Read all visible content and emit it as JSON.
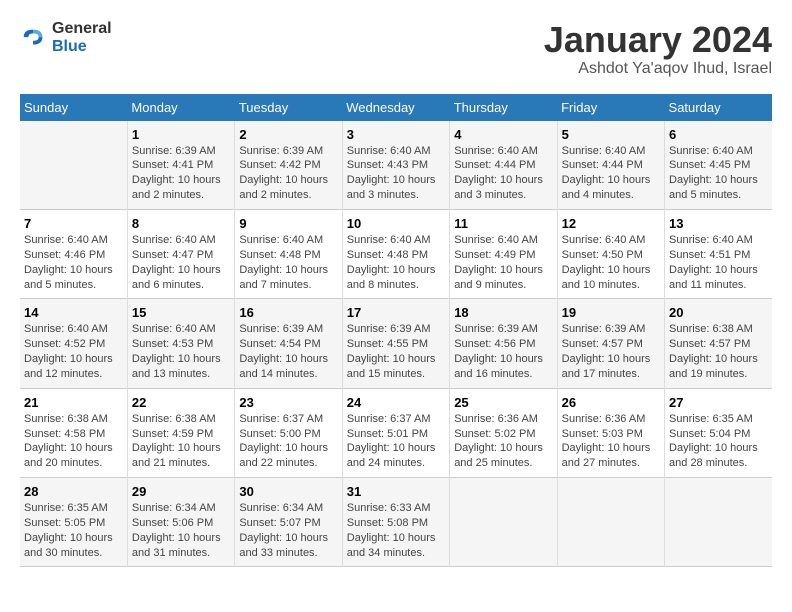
{
  "header": {
    "logo_general": "General",
    "logo_blue": "Blue",
    "title": "January 2024",
    "subtitle": "Ashdot Ya'aqov Ihud, Israel"
  },
  "weekdays": [
    "Sunday",
    "Monday",
    "Tuesday",
    "Wednesday",
    "Thursday",
    "Friday",
    "Saturday"
  ],
  "weeks": [
    [
      {
        "day": "",
        "lines": []
      },
      {
        "day": "1",
        "lines": [
          "Sunrise: 6:39 AM",
          "Sunset: 4:41 PM",
          "Daylight: 10 hours",
          "and 2 minutes."
        ]
      },
      {
        "day": "2",
        "lines": [
          "Sunrise: 6:39 AM",
          "Sunset: 4:42 PM",
          "Daylight: 10 hours",
          "and 2 minutes."
        ]
      },
      {
        "day": "3",
        "lines": [
          "Sunrise: 6:40 AM",
          "Sunset: 4:43 PM",
          "Daylight: 10 hours",
          "and 3 minutes."
        ]
      },
      {
        "day": "4",
        "lines": [
          "Sunrise: 6:40 AM",
          "Sunset: 4:44 PM",
          "Daylight: 10 hours",
          "and 3 minutes."
        ]
      },
      {
        "day": "5",
        "lines": [
          "Sunrise: 6:40 AM",
          "Sunset: 4:44 PM",
          "Daylight: 10 hours",
          "and 4 minutes."
        ]
      },
      {
        "day": "6",
        "lines": [
          "Sunrise: 6:40 AM",
          "Sunset: 4:45 PM",
          "Daylight: 10 hours",
          "and 5 minutes."
        ]
      }
    ],
    [
      {
        "day": "7",
        "lines": [
          "Sunrise: 6:40 AM",
          "Sunset: 4:46 PM",
          "Daylight: 10 hours",
          "and 5 minutes."
        ]
      },
      {
        "day": "8",
        "lines": [
          "Sunrise: 6:40 AM",
          "Sunset: 4:47 PM",
          "Daylight: 10 hours",
          "and 6 minutes."
        ]
      },
      {
        "day": "9",
        "lines": [
          "Sunrise: 6:40 AM",
          "Sunset: 4:48 PM",
          "Daylight: 10 hours",
          "and 7 minutes."
        ]
      },
      {
        "day": "10",
        "lines": [
          "Sunrise: 6:40 AM",
          "Sunset: 4:48 PM",
          "Daylight: 10 hours",
          "and 8 minutes."
        ]
      },
      {
        "day": "11",
        "lines": [
          "Sunrise: 6:40 AM",
          "Sunset: 4:49 PM",
          "Daylight: 10 hours",
          "and 9 minutes."
        ]
      },
      {
        "day": "12",
        "lines": [
          "Sunrise: 6:40 AM",
          "Sunset: 4:50 PM",
          "Daylight: 10 hours",
          "and 10 minutes."
        ]
      },
      {
        "day": "13",
        "lines": [
          "Sunrise: 6:40 AM",
          "Sunset: 4:51 PM",
          "Daylight: 10 hours",
          "and 11 minutes."
        ]
      }
    ],
    [
      {
        "day": "14",
        "lines": [
          "Sunrise: 6:40 AM",
          "Sunset: 4:52 PM",
          "Daylight: 10 hours",
          "and 12 minutes."
        ]
      },
      {
        "day": "15",
        "lines": [
          "Sunrise: 6:40 AM",
          "Sunset: 4:53 PM",
          "Daylight: 10 hours",
          "and 13 minutes."
        ]
      },
      {
        "day": "16",
        "lines": [
          "Sunrise: 6:39 AM",
          "Sunset: 4:54 PM",
          "Daylight: 10 hours",
          "and 14 minutes."
        ]
      },
      {
        "day": "17",
        "lines": [
          "Sunrise: 6:39 AM",
          "Sunset: 4:55 PM",
          "Daylight: 10 hours",
          "and 15 minutes."
        ]
      },
      {
        "day": "18",
        "lines": [
          "Sunrise: 6:39 AM",
          "Sunset: 4:56 PM",
          "Daylight: 10 hours",
          "and 16 minutes."
        ]
      },
      {
        "day": "19",
        "lines": [
          "Sunrise: 6:39 AM",
          "Sunset: 4:57 PM",
          "Daylight: 10 hours",
          "and 17 minutes."
        ]
      },
      {
        "day": "20",
        "lines": [
          "Sunrise: 6:38 AM",
          "Sunset: 4:57 PM",
          "Daylight: 10 hours",
          "and 19 minutes."
        ]
      }
    ],
    [
      {
        "day": "21",
        "lines": [
          "Sunrise: 6:38 AM",
          "Sunset: 4:58 PM",
          "Daylight: 10 hours",
          "and 20 minutes."
        ]
      },
      {
        "day": "22",
        "lines": [
          "Sunrise: 6:38 AM",
          "Sunset: 4:59 PM",
          "Daylight: 10 hours",
          "and 21 minutes."
        ]
      },
      {
        "day": "23",
        "lines": [
          "Sunrise: 6:37 AM",
          "Sunset: 5:00 PM",
          "Daylight: 10 hours",
          "and 22 minutes."
        ]
      },
      {
        "day": "24",
        "lines": [
          "Sunrise: 6:37 AM",
          "Sunset: 5:01 PM",
          "Daylight: 10 hours",
          "and 24 minutes."
        ]
      },
      {
        "day": "25",
        "lines": [
          "Sunrise: 6:36 AM",
          "Sunset: 5:02 PM",
          "Daylight: 10 hours",
          "and 25 minutes."
        ]
      },
      {
        "day": "26",
        "lines": [
          "Sunrise: 6:36 AM",
          "Sunset: 5:03 PM",
          "Daylight: 10 hours",
          "and 27 minutes."
        ]
      },
      {
        "day": "27",
        "lines": [
          "Sunrise: 6:35 AM",
          "Sunset: 5:04 PM",
          "Daylight: 10 hours",
          "and 28 minutes."
        ]
      }
    ],
    [
      {
        "day": "28",
        "lines": [
          "Sunrise: 6:35 AM",
          "Sunset: 5:05 PM",
          "Daylight: 10 hours",
          "and 30 minutes."
        ]
      },
      {
        "day": "29",
        "lines": [
          "Sunrise: 6:34 AM",
          "Sunset: 5:06 PM",
          "Daylight: 10 hours",
          "and 31 minutes."
        ]
      },
      {
        "day": "30",
        "lines": [
          "Sunrise: 6:34 AM",
          "Sunset: 5:07 PM",
          "Daylight: 10 hours",
          "and 33 minutes."
        ]
      },
      {
        "day": "31",
        "lines": [
          "Sunrise: 6:33 AM",
          "Sunset: 5:08 PM",
          "Daylight: 10 hours",
          "and 34 minutes."
        ]
      },
      {
        "day": "",
        "lines": []
      },
      {
        "day": "",
        "lines": []
      },
      {
        "day": "",
        "lines": []
      }
    ]
  ]
}
